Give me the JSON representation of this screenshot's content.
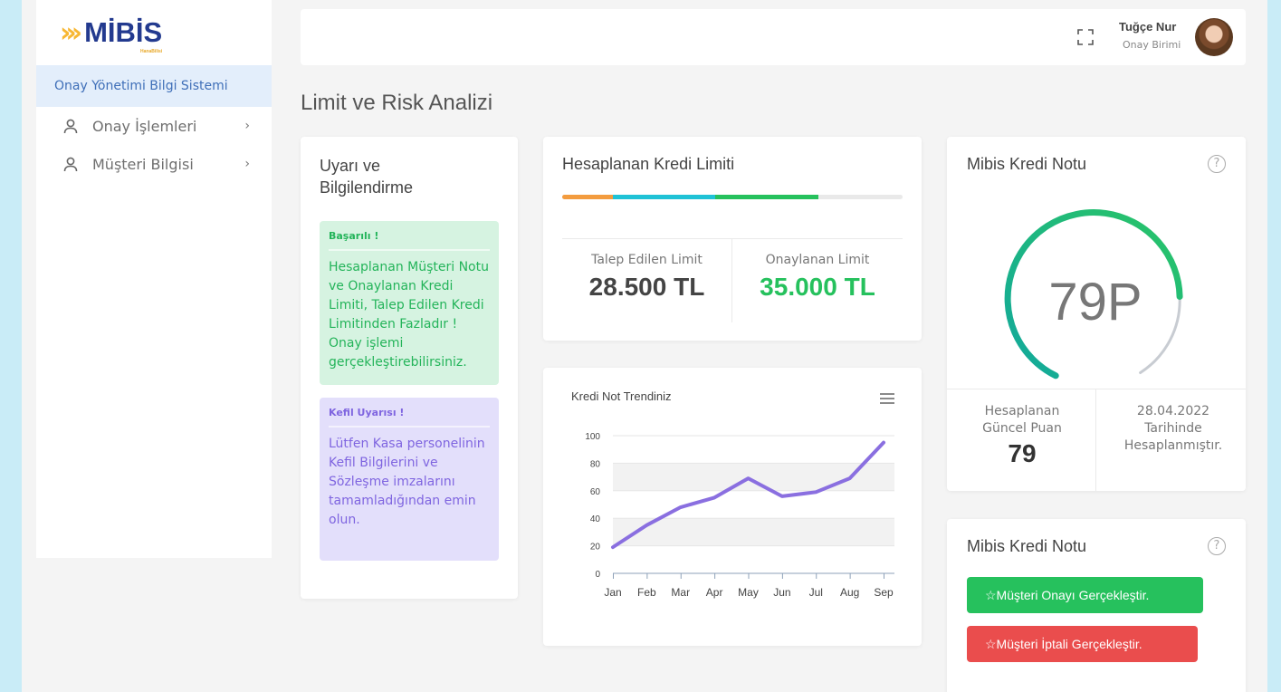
{
  "sidebar": {
    "logo_text": "MİBİS",
    "logo_sub": "HanaBilisi",
    "system_title": "Onay Yönetimi Bilgi Sistemi",
    "items": [
      {
        "label": "Onay İşlemleri",
        "icon": "user-icon"
      },
      {
        "label": "Müşteri Bilgisi",
        "icon": "user-icon"
      }
    ]
  },
  "topbar": {
    "user_name": "Tuğçe Nur",
    "user_role": "Onay Birimi"
  },
  "page_title": "Limit ve Risk Analizi",
  "alerts": {
    "title": "Uyarı ve Bilgilendirme",
    "success": {
      "heading": "Başarılı !",
      "body": "Hesaplanan Müşteri Notu ve Onaylanan Kredi Limiti, Talep Edilen Kredi Limitinden Fazladır ! Onay işlemi gerçekleştirebilirsiniz."
    },
    "warning": {
      "heading": "Kefil Uyarısı !",
      "body": "Lütfen Kasa personelinin Kefil Bilgilerini ve Sözleşme imzalarını tamamladığından emin olun."
    }
  },
  "limit": {
    "title": "Hesaplanan Kredi Limiti",
    "progress_colors": [
      "#f39c3f",
      "#1fc2d6",
      "#26c15d"
    ],
    "requested_label": "Talep Edilen Limit",
    "requested_value": "28.500 TL",
    "approved_label": "Onaylanan Limit",
    "approved_value": "35.000 TL",
    "approved_color": "#26c15d"
  },
  "score": {
    "title": "Mibis Kredi Notu",
    "gauge_text": "79P",
    "current_label": "Hesaplanan Güncel Puan",
    "current_value": "79",
    "date_text": "28.04.2022 Tarihinde Hesaplanmıştır."
  },
  "actions": {
    "title": "Mibis Kredi Notu",
    "approve_label": "☆Müşteri Onayı Gerçekleştir.",
    "cancel_label": "☆Müşteri İptali Gerçekleştir."
  },
  "chart_data": {
    "type": "line",
    "title": "Kredi Not Trendiniz",
    "categories": [
      "Jan",
      "Feb",
      "Mar",
      "Apr",
      "May",
      "Jun",
      "Jul",
      "Aug",
      "Sep"
    ],
    "series": [
      {
        "values": [
          19,
          35,
          48,
          55,
          69,
          56,
          59,
          69,
          95
        ],
        "color": "#8a6fe0"
      }
    ],
    "yticks": [
      "0",
      "20",
      "40",
      "60",
      "80",
      "100"
    ],
    "ylim": [
      0,
      100
    ],
    "grid": true
  }
}
